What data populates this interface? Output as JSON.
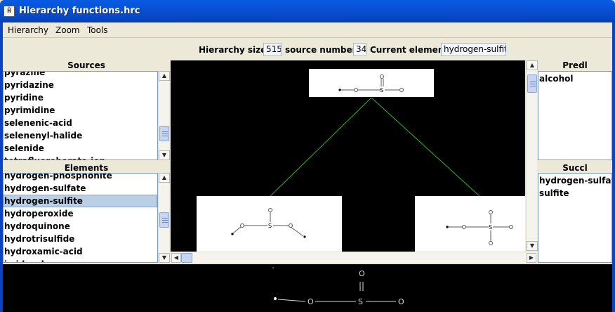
{
  "window": {
    "title": "Hierarchy functions.hrc",
    "icon": "app-icon"
  },
  "menu": [
    "Hierarchy",
    "Zoom",
    "Tools"
  ],
  "info": {
    "size_label": "Hierarchy size:",
    "size_value": "515",
    "source_label": "source number:",
    "source_value": "34",
    "current_label": "Current element:",
    "current_value": "hydrogen-sulfite"
  },
  "sources": {
    "title": "Sources",
    "items": [
      "pyrazine",
      "pyridazine",
      "pyridine",
      "pyrimidine",
      "selenenic-acid",
      "selenenyl-halide",
      "selenide",
      "tetrafluoroborate-ion"
    ]
  },
  "elements": {
    "title": "Elements",
    "items": [
      "hydrogen-phosphonite",
      "hydrogen-sulfate",
      "hydrogen-sulfite",
      "hydroperoxide",
      "hydroquinone",
      "hydrotrisulfide",
      "hydroxamic-acid",
      "imidazole"
    ],
    "selected_index": 2
  },
  "pred": {
    "title": "Predl",
    "items": [
      "alcohol"
    ]
  },
  "succ": {
    "title": "Succl",
    "items": [
      "hydrogen-sulfate",
      "sulfite"
    ]
  },
  "molecule": {
    "o": "O",
    "s": "S"
  },
  "colors": {
    "edge": "#2fb52f",
    "selection": "#b8cfe5",
    "title_bar": "#0a4ecf"
  }
}
